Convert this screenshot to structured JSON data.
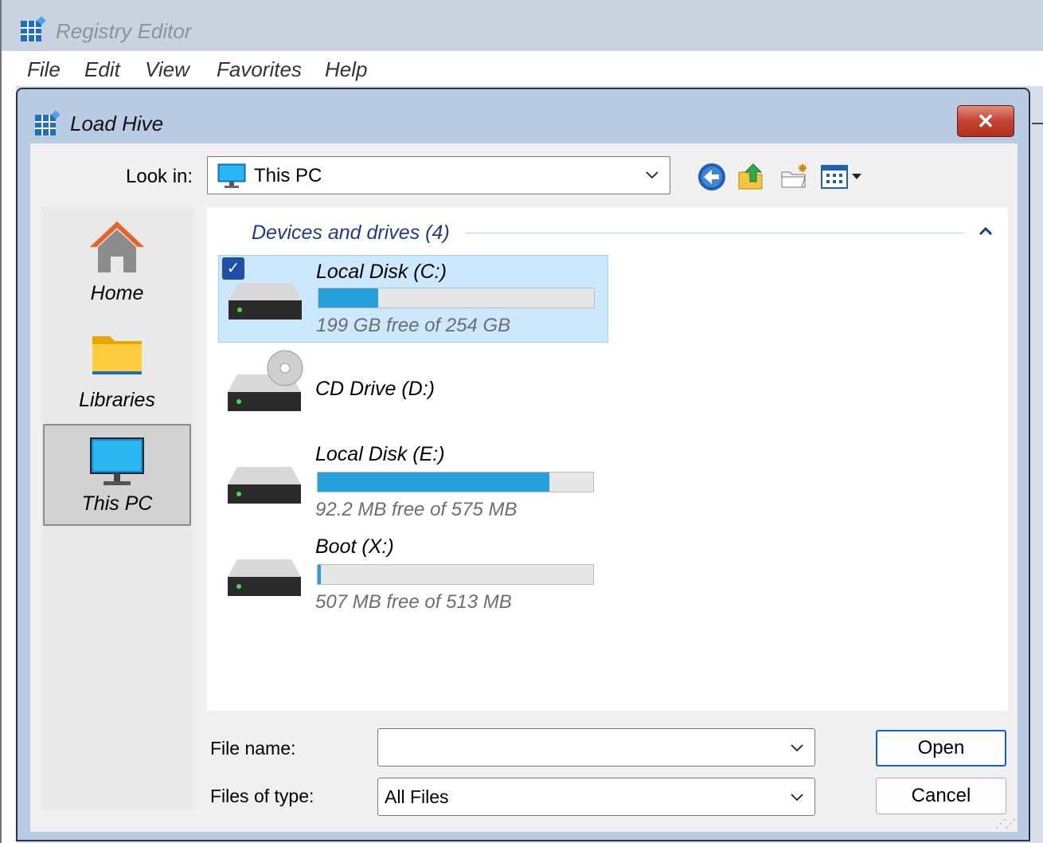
{
  "background_window": {
    "title": "Registry Editor",
    "menu": [
      "File",
      "Edit",
      "View",
      "Favorites",
      "Help"
    ]
  },
  "dialog": {
    "title": "Load Hive",
    "close_label": "✕",
    "look_in_label": "Look in:",
    "look_in_value": "This PC",
    "toolbar_icons": [
      "back-icon",
      "up-folder-icon",
      "new-folder-icon",
      "view-menu-icon"
    ],
    "places": [
      {
        "label": "Home",
        "icon": "home-icon",
        "selected": false
      },
      {
        "label": "Libraries",
        "icon": "folder-icon",
        "selected": false
      },
      {
        "label": "This PC",
        "icon": "monitor-icon",
        "selected": true
      }
    ],
    "group_header": "Devices and drives (4)",
    "drives": [
      {
        "name": "Local Disk (C:)",
        "free_text": "199 GB free of 254 GB",
        "used_fraction": 0.217,
        "selected": true,
        "type": "disk"
      },
      {
        "name": "CD Drive (D:)",
        "free_text": "",
        "used_fraction": null,
        "selected": false,
        "type": "cd"
      },
      {
        "name": "Local Disk (E:)",
        "free_text": "92.2 MB free of 575 MB",
        "used_fraction": 0.84,
        "selected": false,
        "type": "disk"
      },
      {
        "name": "Boot (X:)",
        "free_text": "507 MB free of 513 MB",
        "used_fraction": 0.012,
        "selected": false,
        "type": "disk"
      }
    ],
    "file_name_label": "File name:",
    "file_name_value": "",
    "files_of_type_label": "Files of type:",
    "files_of_type_value": "All Files",
    "open_label": "Open",
    "cancel_label": "Cancel"
  },
  "colors": {
    "accent": "#26a0da",
    "selection": "#cce8ff",
    "group_header": "#1f3c88"
  }
}
